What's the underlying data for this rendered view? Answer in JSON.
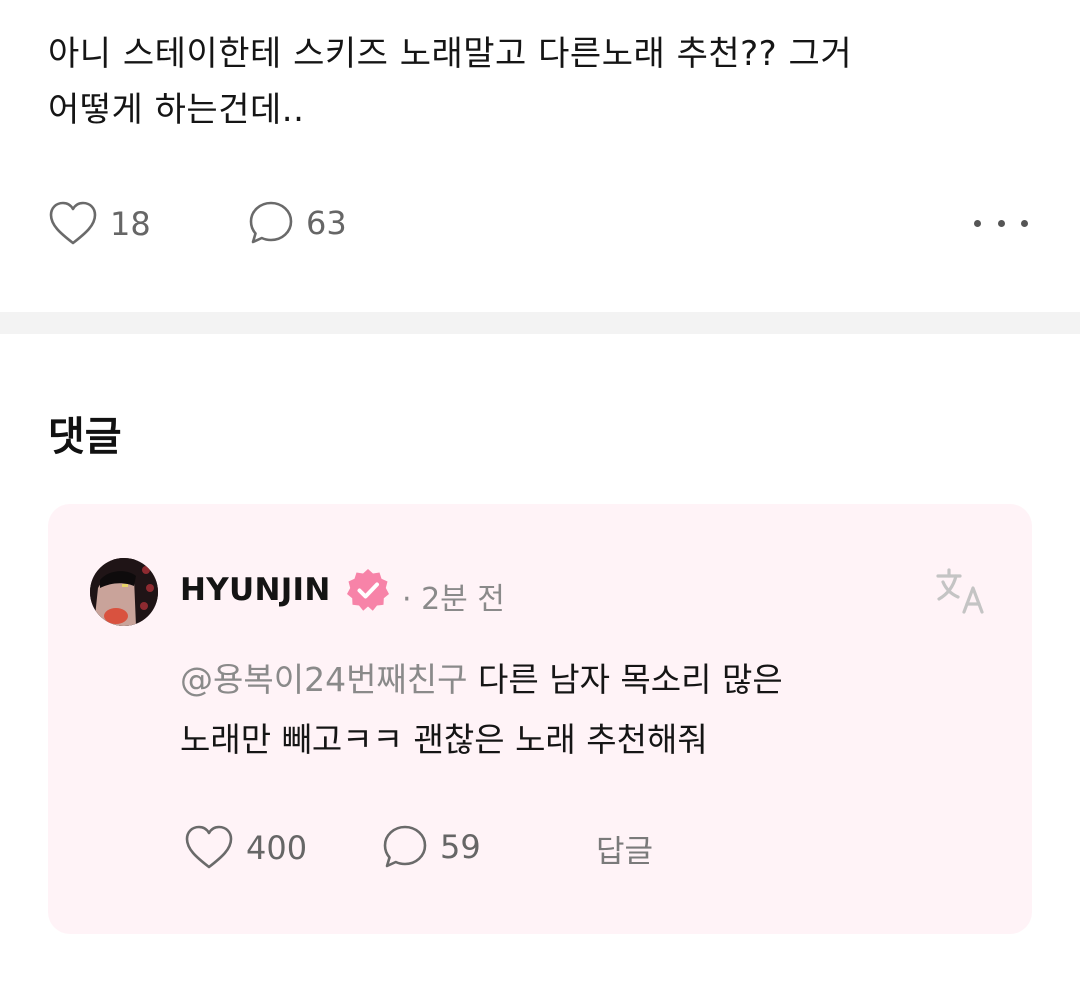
{
  "post": {
    "text_line1": "아니 스테이한테 스키즈 노래말고 다른노래 추천?? 그거",
    "text_line2": "어떻게 하는건데..",
    "like_count": "18",
    "comment_count": "63",
    "more_icon": "more-horizontal-icon"
  },
  "comments_section": {
    "heading": "댓글"
  },
  "comment": {
    "username": "HYUNJIN",
    "timestamp": "· 2분 전",
    "mention": "@용복이24번째친구",
    "text_rest_line1": " 다른 남자 목소리 많은",
    "text_line2": "노래만 빼고ㅋㅋ 괜찮은 노래 추천해줘",
    "like_count": "400",
    "reply_count": "59",
    "reply_label": "답글",
    "verified_icon": "verified-badge-icon",
    "translate_icon": "translate-icon"
  },
  "colors": {
    "card_background": "#fff3f7",
    "verified_badge": "#f783a8",
    "muted_text": "#8a8a8a",
    "divider": "#f3f3f3"
  }
}
